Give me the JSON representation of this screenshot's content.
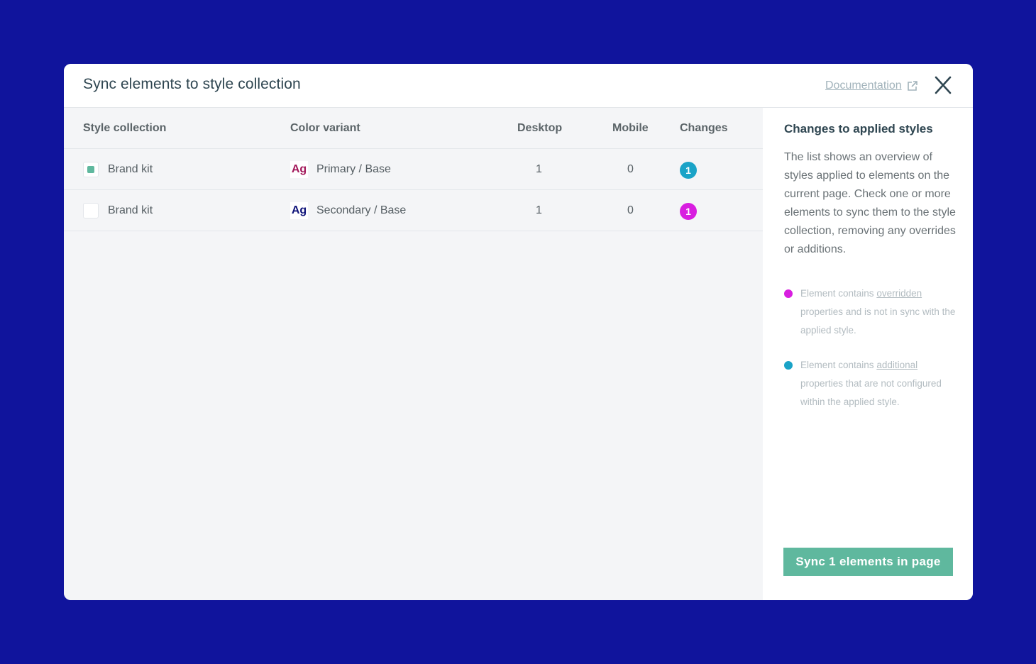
{
  "modal": {
    "title": "Sync elements to style collection",
    "documentation_label": "Documentation"
  },
  "table": {
    "columns": [
      "Style collection",
      "Color variant",
      "Desktop",
      "Mobile",
      "Changes"
    ],
    "rows": [
      {
        "checked": true,
        "collection": "Brand kit",
        "swatch_text": "Ag",
        "swatch_color": "#a3195b",
        "variant": "Primary / Base",
        "desktop": "1",
        "mobile": "0",
        "changes": "1",
        "changes_color": "#1aa3c7"
      },
      {
        "checked": false,
        "collection": "Brand kit",
        "swatch_text": "Ag",
        "swatch_color": "#10147a",
        "variant": "Secondary / Base",
        "desktop": "1",
        "mobile": "0",
        "changes": "1",
        "changes_color": "#d81ee0"
      }
    ]
  },
  "side": {
    "title": "Changes to applied styles",
    "description": "The list shows an overview of styles applied to elements on the current page. Check one or more elements to sync them to the style collection, removing any overrides or additions.",
    "legend": [
      {
        "color": "#d81ee0",
        "prefix": "Element contains ",
        "link": "overridden",
        "suffix": " properties and is not in sync with the applied style."
      },
      {
        "color": "#1aa3c7",
        "prefix": "Element contains ",
        "link": "additional",
        "suffix": " properties that are not configured within the applied style."
      }
    ],
    "sync_label": "Sync 1 elements in page"
  },
  "colors": {
    "background": "#10149c",
    "accent": "#5fb89e",
    "override": "#d81ee0",
    "additional": "#1aa3c7"
  }
}
